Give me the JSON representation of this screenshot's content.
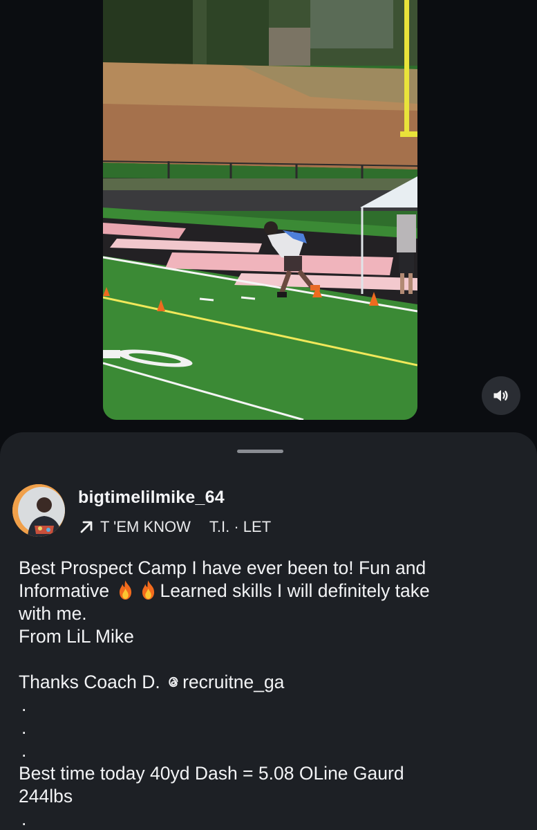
{
  "video": {
    "scene": "football-field-sprint",
    "mute_icon": "speaker-icon"
  },
  "post": {
    "username": "bigtimelilmike_64",
    "music_icon": "arrow-up-right-icon",
    "music_track": "T 'EM KNOW",
    "music_artist": "T.I. · LET",
    "caption": {
      "line1": "Best Prospect Camp I have ever been to! Fun and",
      "line2a": "Informative",
      "line2b": "Learned skills I will definitely take",
      "line3": "with me.",
      "line4": "From LiL Mike",
      "line5_prefix": "Thanks Coach D.",
      "mention": "recruitne_ga",
      "dot1": ".",
      "dot2": ".",
      "dot3": ".",
      "line6": "Best time today 40yd Dash = 5.08 OLine Gaurd",
      "line7": "244lbs",
      "dot4": "."
    },
    "emoji_icon": "fire-emoji-icon"
  },
  "colors": {
    "sheet_bg": "#1d2025",
    "page_bg": "#0b0d11",
    "avatar_ring": "#f0a04a"
  }
}
